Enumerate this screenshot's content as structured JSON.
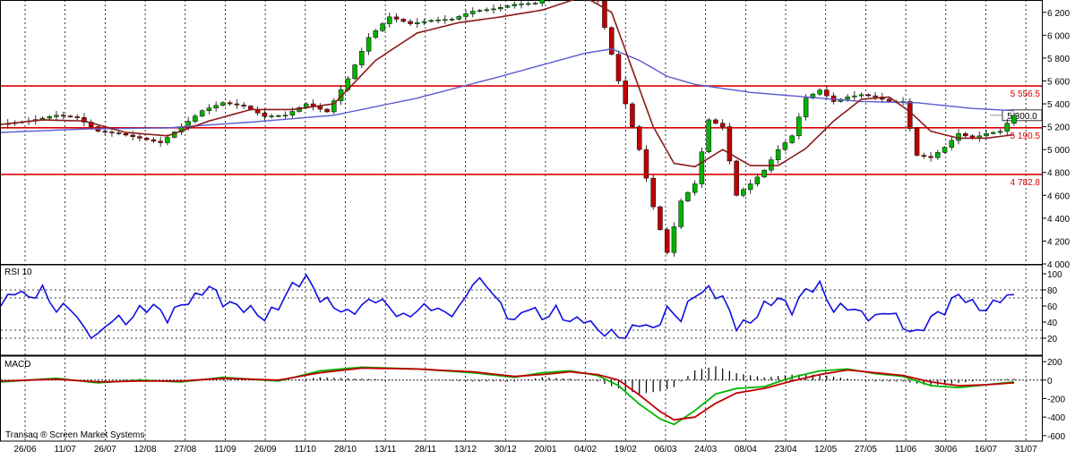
{
  "app": {
    "credit": "Transaq ® Screen Market Systems"
  },
  "chart_data": {
    "type": "candlestick",
    "x_ticks": [
      "26/06",
      "11/07",
      "26/07",
      "12/08",
      "27/08",
      "11/09",
      "26/09",
      "11/10",
      "28/10",
      "13/11",
      "28/11",
      "13/12",
      "30/12",
      "20/01",
      "04/02",
      "19/02",
      "06/03",
      "24/03",
      "08/04",
      "23/04",
      "12/05",
      "27/05",
      "11/06",
      "30/06",
      "16/07",
      "31/07"
    ],
    "price_panel": {
      "ylim": [
        4000,
        6300
      ],
      "y_ticks": [
        6200,
        6000,
        5800,
        5600,
        5400,
        5200,
        5000,
        4800,
        4600,
        4400,
        4200,
        4000
      ],
      "y_tick_labels": [
        "6 200",
        "6 000",
        "5 800",
        "5 600",
        "5 400",
        "5 200",
        "5 000",
        "4 800",
        "4 600",
        "4 400",
        "4 200",
        "4 000"
      ],
      "levels": [
        {
          "value": 5556.5,
          "label": "5 556.5"
        },
        {
          "value": 5190.5,
          "label": "5 190.5"
        },
        {
          "value": 4782.8,
          "label": "4 782.8"
        }
      ],
      "last_price": {
        "value": 5300,
        "label": "5 300.0"
      },
      "close_path": [
        [
          0,
          5220
        ],
        [
          4,
          5250
        ],
        [
          8,
          5300
        ],
        [
          11,
          5280
        ],
        [
          14,
          5160
        ],
        [
          17,
          5140
        ],
        [
          20,
          5100
        ],
        [
          23,
          5060
        ],
        [
          26,
          5200
        ],
        [
          29,
          5340
        ],
        [
          32,
          5410
        ],
        [
          35,
          5380
        ],
        [
          38,
          5290
        ],
        [
          41,
          5300
        ],
        [
          44,
          5400
        ],
        [
          47,
          5330
        ],
        [
          50,
          5620
        ],
        [
          53,
          5980
        ],
        [
          56,
          6160
        ],
        [
          59,
          6100
        ],
        [
          62,
          6130
        ],
        [
          65,
          6140
        ],
        [
          68,
          6210
        ],
        [
          71,
          6230
        ],
        [
          74,
          6270
        ],
        [
          77,
          6280
        ],
        [
          80,
          6400
        ],
        [
          83,
          6350
        ],
        [
          86,
          6300
        ],
        [
          89,
          5600
        ],
        [
          92,
          5000
        ],
        [
          94,
          4500
        ],
        [
          96,
          4100
        ],
        [
          98,
          4550
        ],
        [
          100,
          4700
        ],
        [
          102,
          5260
        ],
        [
          104,
          5200
        ],
        [
          106,
          4600
        ],
        [
          108,
          4700
        ],
        [
          110,
          4820
        ],
        [
          112,
          5000
        ],
        [
          114,
          5120
        ],
        [
          116,
          5450
        ],
        [
          118,
          5520
        ],
        [
          120,
          5420
        ],
        [
          122,
          5460
        ],
        [
          124,
          5480
        ],
        [
          126,
          5460
        ],
        [
          128,
          5420
        ],
        [
          130,
          5420
        ],
        [
          132,
          4950
        ],
        [
          134,
          4930
        ],
        [
          136,
          5020
        ],
        [
          138,
          5140
        ],
        [
          140,
          5100
        ],
        [
          142,
          5140
        ],
        [
          144,
          5160
        ],
        [
          146,
          5300
        ]
      ],
      "ma_short_path": [
        [
          0,
          5220
        ],
        [
          6,
          5260
        ],
        [
          12,
          5250
        ],
        [
          18,
          5150
        ],
        [
          24,
          5120
        ],
        [
          30,
          5250
        ],
        [
          36,
          5350
        ],
        [
          42,
          5350
        ],
        [
          48,
          5400
        ],
        [
          54,
          5780
        ],
        [
          60,
          6020
        ],
        [
          66,
          6110
        ],
        [
          72,
          6160
        ],
        [
          78,
          6220
        ],
        [
          84,
          6340
        ],
        [
          88,
          6200
        ],
        [
          91,
          5700
        ],
        [
          94,
          5200
        ],
        [
          97,
          4880
        ],
        [
          100,
          4850
        ],
        [
          104,
          5000
        ],
        [
          108,
          4860
        ],
        [
          112,
          4860
        ],
        [
          116,
          5010
        ],
        [
          120,
          5250
        ],
        [
          124,
          5440
        ],
        [
          128,
          5460
        ],
        [
          131,
          5330
        ],
        [
          134,
          5160
        ],
        [
          138,
          5100
        ],
        [
          142,
          5100
        ],
        [
          146,
          5130
        ]
      ],
      "ma_long_path": [
        [
          0,
          5150
        ],
        [
          12,
          5180
        ],
        [
          24,
          5190
        ],
        [
          36,
          5240
        ],
        [
          48,
          5300
        ],
        [
          60,
          5450
        ],
        [
          72,
          5640
        ],
        [
          84,
          5840
        ],
        [
          88,
          5880
        ],
        [
          92,
          5780
        ],
        [
          96,
          5640
        ],
        [
          100,
          5570
        ],
        [
          108,
          5500
        ],
        [
          116,
          5460
        ],
        [
          124,
          5420
        ],
        [
          132,
          5410
        ],
        [
          140,
          5360
        ],
        [
          146,
          5340
        ]
      ]
    },
    "rsi_panel": {
      "label": "RSI 10",
      "ylim": [
        0,
        110
      ],
      "y_ticks": [
        100,
        80,
        60,
        40,
        20
      ],
      "y_tick_labels": [
        "100",
        "80",
        "60",
        "40",
        "20"
      ],
      "guides": [
        80,
        70,
        30,
        20
      ],
      "path": [
        [
          0,
          60
        ],
        [
          2,
          80
        ],
        [
          4,
          70
        ],
        [
          6,
          80
        ],
        [
          8,
          55
        ],
        [
          10,
          60
        ],
        [
          12,
          30
        ],
        [
          14,
          22
        ],
        [
          16,
          45
        ],
        [
          18,
          40
        ],
        [
          20,
          55
        ],
        [
          22,
          60
        ],
        [
          24,
          45
        ],
        [
          26,
          62
        ],
        [
          28,
          70
        ],
        [
          30,
          85
        ],
        [
          32,
          65
        ],
        [
          34,
          60
        ],
        [
          36,
          55
        ],
        [
          38,
          45
        ],
        [
          40,
          60
        ],
        [
          42,
          85
        ],
        [
          44,
          95
        ],
        [
          46,
          70
        ],
        [
          48,
          60
        ],
        [
          50,
          50
        ],
        [
          52,
          60
        ],
        [
          54,
          70
        ],
        [
          56,
          58
        ],
        [
          58,
          45
        ],
        [
          60,
          55
        ],
        [
          62,
          60
        ],
        [
          64,
          50
        ],
        [
          66,
          55
        ],
        [
          68,
          90
        ],
        [
          70,
          88
        ],
        [
          72,
          60
        ],
        [
          74,
          40
        ],
        [
          76,
          60
        ],
        [
          78,
          45
        ],
        [
          80,
          55
        ],
        [
          82,
          40
        ],
        [
          84,
          45
        ],
        [
          86,
          30
        ],
        [
          88,
          25
        ],
        [
          90,
          22
        ],
        [
          92,
          40
        ],
        [
          94,
          30
        ],
        [
          96,
          55
        ],
        [
          98,
          45
        ],
        [
          100,
          75
        ],
        [
          102,
          80
        ],
        [
          104,
          70
        ],
        [
          106,
          35
        ],
        [
          108,
          40
        ],
        [
          110,
          60
        ],
        [
          112,
          70
        ],
        [
          114,
          55
        ],
        [
          116,
          80
        ],
        [
          118,
          85
        ],
        [
          120,
          55
        ],
        [
          122,
          60
        ],
        [
          124,
          50
        ],
        [
          126,
          45
        ],
        [
          128,
          55
        ],
        [
          130,
          35
        ],
        [
          132,
          25
        ],
        [
          134,
          45
        ],
        [
          136,
          55
        ],
        [
          138,
          75
        ],
        [
          140,
          62
        ],
        [
          142,
          55
        ],
        [
          144,
          70
        ],
        [
          146,
          72
        ]
      ]
    },
    "macd_panel": {
      "label": "MACD",
      "ylim": [
        -650,
        250
      ],
      "y_ticks": [
        200,
        0,
        -200,
        -400,
        -600
      ],
      "y_tick_labels": [
        "200",
        "0",
        "-200",
        "-400",
        "-600"
      ],
      "macd_path": [
        [
          0,
          -20
        ],
        [
          8,
          20
        ],
        [
          14,
          -30
        ],
        [
          20,
          0
        ],
        [
          26,
          -20
        ],
        [
          32,
          30
        ],
        [
          40,
          -10
        ],
        [
          46,
          100
        ],
        [
          52,
          140
        ],
        [
          60,
          120
        ],
        [
          68,
          80
        ],
        [
          74,
          30
        ],
        [
          78,
          80
        ],
        [
          82,
          100
        ],
        [
          86,
          50
        ],
        [
          89,
          -60
        ],
        [
          92,
          -260
        ],
        [
          95,
          -420
        ],
        [
          97,
          -480
        ],
        [
          100,
          -330
        ],
        [
          103,
          -150
        ],
        [
          106,
          -90
        ],
        [
          110,
          -70
        ],
        [
          114,
          30
        ],
        [
          118,
          100
        ],
        [
          122,
          120
        ],
        [
          126,
          70
        ],
        [
          130,
          40
        ],
        [
          134,
          -60
        ],
        [
          138,
          -80
        ],
        [
          142,
          -50
        ],
        [
          146,
          -20
        ]
      ],
      "signal_path": [
        [
          0,
          -10
        ],
        [
          8,
          10
        ],
        [
          14,
          -20
        ],
        [
          20,
          -10
        ],
        [
          26,
          -10
        ],
        [
          32,
          20
        ],
        [
          40,
          0
        ],
        [
          46,
          80
        ],
        [
          52,
          130
        ],
        [
          60,
          120
        ],
        [
          68,
          90
        ],
        [
          74,
          40
        ],
        [
          78,
          60
        ],
        [
          82,
          90
        ],
        [
          86,
          60
        ],
        [
          89,
          0
        ],
        [
          92,
          -160
        ],
        [
          95,
          -340
        ],
        [
          97,
          -430
        ],
        [
          100,
          -400
        ],
        [
          103,
          -250
        ],
        [
          106,
          -140
        ],
        [
          110,
          -90
        ],
        [
          114,
          -10
        ],
        [
          118,
          60
        ],
        [
          122,
          110
        ],
        [
          126,
          80
        ],
        [
          130,
          50
        ],
        [
          134,
          -20
        ],
        [
          138,
          -60
        ],
        [
          142,
          -50
        ],
        [
          146,
          -30
        ]
      ]
    }
  }
}
